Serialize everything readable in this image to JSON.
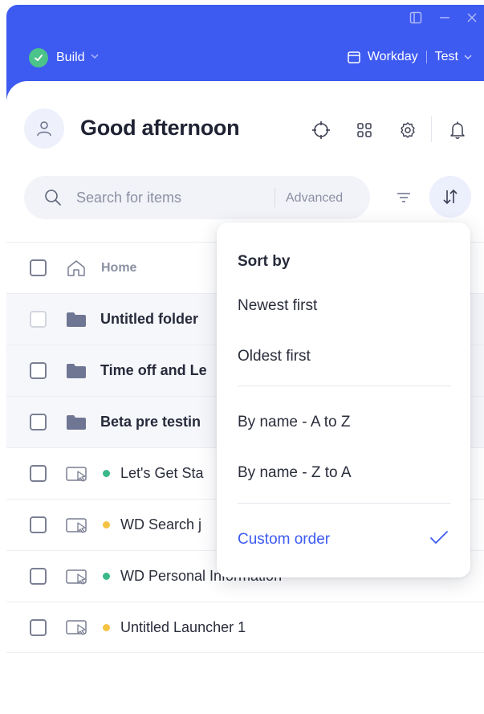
{
  "window": {
    "sidebar_toggle_icon": "sidebar-panel-icon",
    "minimize_icon": "minimize-icon",
    "close_icon": "close-icon",
    "accent_color": "#3d5af1"
  },
  "topbar": {
    "mode_label": "Build",
    "environment": {
      "app": "Workday",
      "env": "Test"
    }
  },
  "header": {
    "greeting": "Good afternoon"
  },
  "search": {
    "placeholder": "Search for items",
    "advanced_label": "Advanced"
  },
  "list": {
    "breadcrumb": "Home",
    "items": [
      {
        "label": "Untitled folder",
        "type": "folder"
      },
      {
        "label": "Time off and Le",
        "type": "folder"
      },
      {
        "label": "Beta pre testin",
        "type": "folder"
      },
      {
        "label": "Let's Get Sta",
        "type": "launcher",
        "status_color": "#3bb88a"
      },
      {
        "label": "WD Search j",
        "type": "launcher",
        "status_color": "#f5c242"
      },
      {
        "label": "WD Personal Information",
        "type": "launcher",
        "status_color": "#3bb88a"
      },
      {
        "label": "Untitled Launcher 1",
        "type": "launcher",
        "status_color": "#f5c242"
      }
    ]
  },
  "sort_menu": {
    "title": "Sort by",
    "options": [
      "Newest first",
      "Oldest first",
      "By name - A to Z",
      "By name - Z to A",
      "Custom order"
    ],
    "selected": "Custom order"
  }
}
